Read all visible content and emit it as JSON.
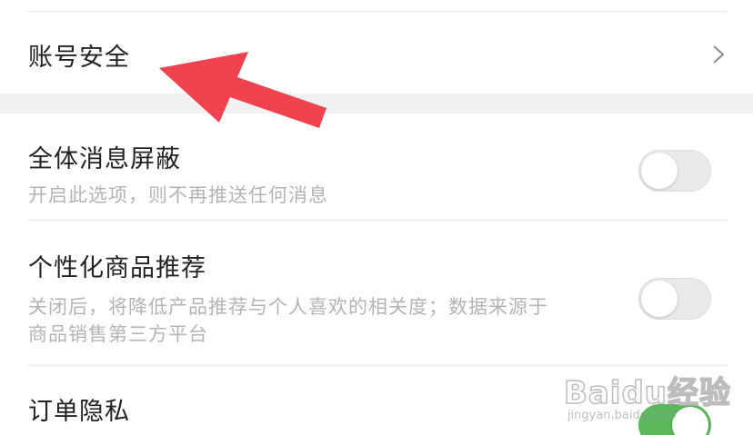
{
  "settings": {
    "account": {
      "title": "账号安全"
    },
    "mute_all": {
      "title": "全体消息屏蔽",
      "subtitle": "开启此选项，则不再推送任何消息",
      "enabled": false
    },
    "personalized": {
      "title": "个性化商品推荐",
      "subtitle": "关闭后，将降低产品推荐与个人喜欢的相关度；数据来源于商品销售第三方平台",
      "enabled": false
    },
    "order_privacy": {
      "title": "订单隐私",
      "enabled": true
    }
  },
  "colors": {
    "toggle_on": "#5bb85d",
    "toggle_off": "#e9e9e9",
    "annotation_arrow": "#f0434f"
  },
  "watermark": {
    "logo": "Baidu经验",
    "url": "jingyan.baidu.com"
  }
}
